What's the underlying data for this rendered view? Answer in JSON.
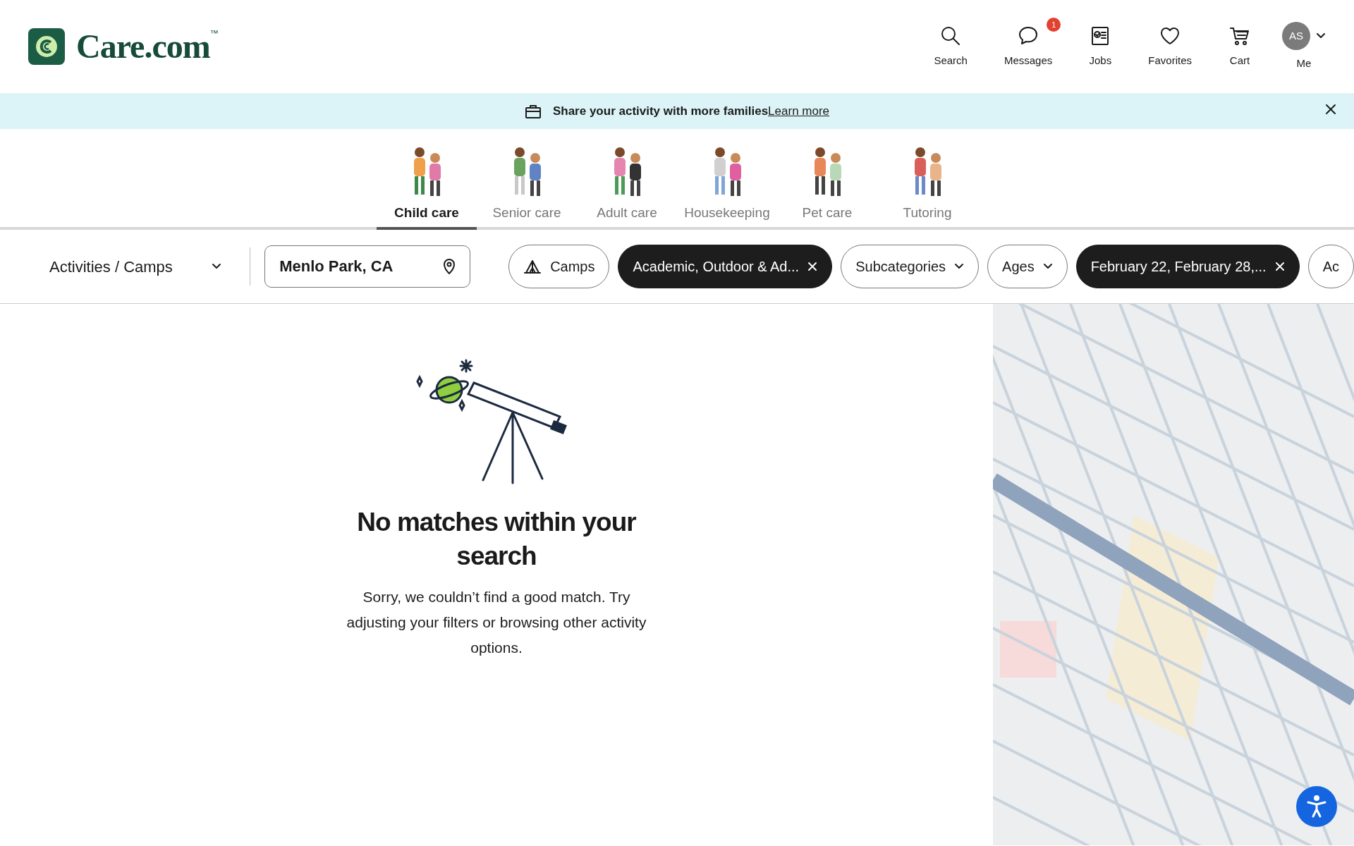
{
  "header": {
    "logo": "Care.com",
    "trademark": "™",
    "nav": [
      {
        "label": "Search",
        "kind": "search"
      },
      {
        "label": "Messages",
        "kind": "chat",
        "badge": "1"
      },
      {
        "label": "Jobs",
        "kind": "jobs"
      },
      {
        "label": "Favorites",
        "kind": "heart"
      },
      {
        "label": "Cart",
        "kind": "cart"
      }
    ],
    "account": {
      "initials": "AS",
      "label": "Me"
    }
  },
  "banner": {
    "text": "Share your activity with more families",
    "link": "Learn more"
  },
  "categories": [
    {
      "label": "Child care",
      "selected": true
    },
    {
      "label": "Senior care",
      "selected": false
    },
    {
      "label": "Adult care",
      "selected": false
    },
    {
      "label": "Housekeeping",
      "selected": false
    },
    {
      "label": "Pet care",
      "selected": false
    },
    {
      "label": "Tutoring",
      "selected": false
    }
  ],
  "filters": {
    "service": "Activities / Camps",
    "location": "Menlo Park, CA",
    "chips": [
      {
        "kind": "toggle",
        "label": "Camps",
        "selected": false
      },
      {
        "kind": "removable",
        "label": "Academic, Outdoor & Ad...",
        "selected": true
      },
      {
        "kind": "dropdown",
        "label": "Subcategories",
        "selected": false
      },
      {
        "kind": "dropdown",
        "label": "Ages",
        "selected": false
      },
      {
        "kind": "removable",
        "label": "February 22, February 28,...",
        "selected": true
      },
      {
        "kind": "plain",
        "label": "Ac",
        "selected": false
      }
    ]
  },
  "empty_state": {
    "title": "No matches within your search",
    "message": "Sorry, we couldn’t find a good match. Try adjusting your filters or browsing other activity options."
  }
}
